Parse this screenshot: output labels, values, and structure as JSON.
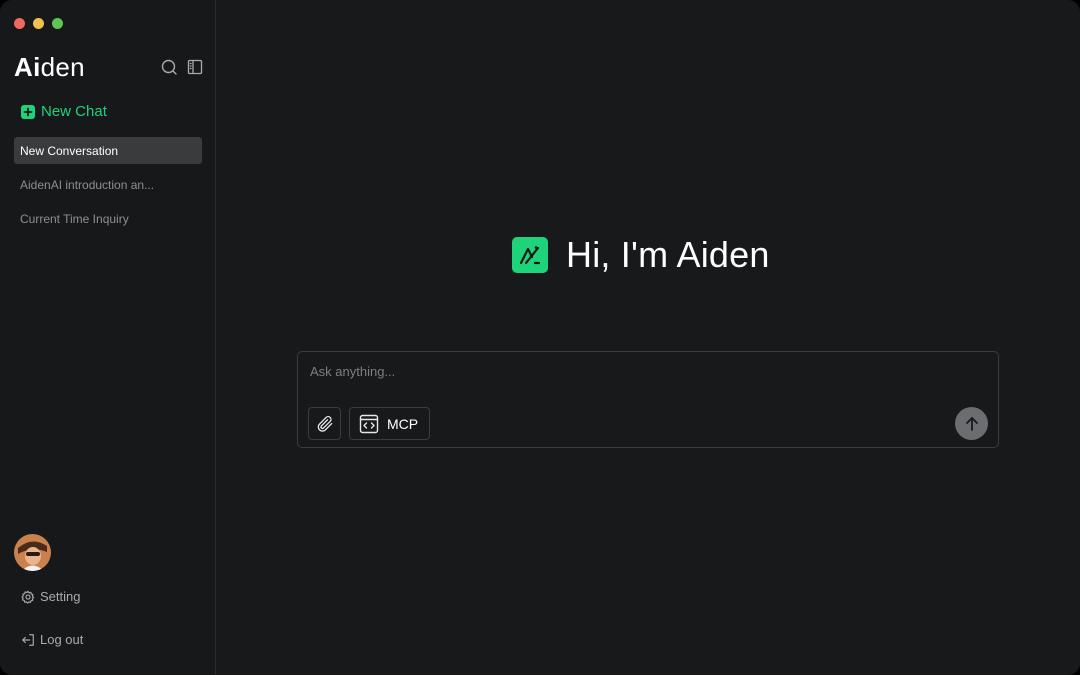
{
  "window": {
    "traffic_lights": {
      "close_color": "#ee6a5e",
      "minimize_color": "#f5bf4f",
      "zoom_color": "#61c554"
    }
  },
  "sidebar": {
    "brand_bold": "Ai",
    "brand_light": "den",
    "search_icon": "search-icon",
    "toggle_icon": "sidebar-toggle-icon",
    "new_chat_label": "New Chat",
    "accent_color": "#1ed37a",
    "conversations": [
      {
        "label": "New Conversation",
        "active": true
      },
      {
        "label": "AidenAI introduction an...",
        "active": false
      },
      {
        "label": "Current Time Inquiry",
        "active": false
      }
    ],
    "setting_label": "Setting",
    "logout_label": "Log out"
  },
  "main": {
    "greeting": "Hi, I'm Aiden",
    "composer": {
      "placeholder": "Ask anything...",
      "value": "",
      "attach_icon": "paperclip-icon",
      "mcp_label": "MCP",
      "mcp_icon": "code-window-icon",
      "send_icon": "arrow-up-icon"
    }
  }
}
